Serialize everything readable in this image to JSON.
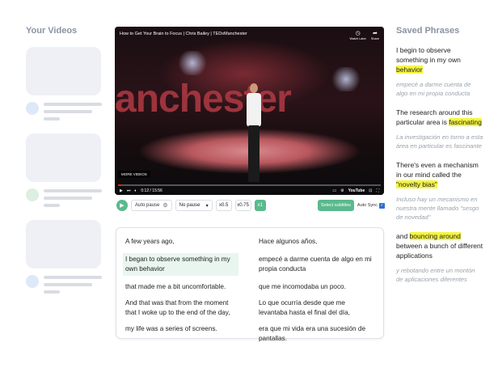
{
  "sidebar": {
    "title": "Your Videos"
  },
  "video": {
    "title": "How to Get Your Brain to Focus | Chris Bailey | TEDxManchester",
    "backdrop_text": "anchester",
    "watch_later": "Watch Later",
    "share": "Share",
    "more_videos": "MORE VIDEOS",
    "time": "0:12 / 15:56",
    "progress": 0.013,
    "youtube": "YouTube"
  },
  "toolbar": {
    "auto_pause": "Auto pause",
    "pause_mode": "No pause",
    "speeds": [
      "x0.5",
      "x0.75",
      "x1"
    ],
    "active_speed_index": 2,
    "select_subtitles": "Select subtitles",
    "auto_sync": "Auto Sync"
  },
  "transcript": {
    "english": [
      "A few years ago,",
      "I began to observe something in my own behavior",
      "that made me a bit uncomfortable.",
      "And that was that from the moment that I woke up to the end of the day,",
      "my life was a series of screens."
    ],
    "spanish": [
      "Hace algunos años,",
      "empecé a darme cuenta de algo en mi propia conducta",
      "que me incomodaba un poco.",
      "Lo que ocurría desde que me levantaba hasta el final del día,",
      "era que mi vida era una sucesión de pantallas."
    ],
    "highlighted_index": 1
  },
  "saved": {
    "title": "Saved Phrases",
    "phrases": [
      {
        "pre": "I begin to observe something in my own ",
        "mark": "behavior",
        "post": "",
        "translation": "empecé a darme cuenta de algo en mi propia conducta"
      },
      {
        "pre": "The research around this particular area is ",
        "mark": "fascinating",
        "post": "",
        "translation": "La investigación en torno a esta área en particular es fascinante"
      },
      {
        "pre": "There's even a mechanism in our mind called the ",
        "mark": "\"novelty bias\"",
        "post": "",
        "translation": "Incluso hay un mecanismo en nuestra mente llamado \"sesgo de novedad\""
      },
      {
        "pre": "and ",
        "mark": "bouncing around",
        "post": " between a bunch of different applications",
        "translation": "y rebotando entre un montón de aplicaciones diferentes"
      }
    ]
  },
  "colors": {
    "accent": "#5aba8c",
    "highlight": "#f5f542",
    "progress_red": "#e62117"
  }
}
